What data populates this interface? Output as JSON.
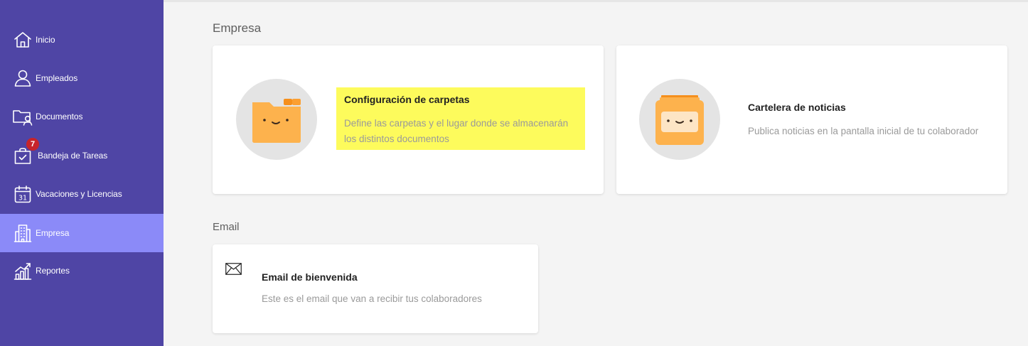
{
  "sidebar": {
    "items": [
      {
        "label": "Inicio",
        "icon": "home-icon"
      },
      {
        "label": "Empleados",
        "icon": "person-icon"
      },
      {
        "label": "Documentos",
        "icon": "folder-person-icon"
      },
      {
        "label": "Bandeja de Tareas",
        "icon": "task-bag-icon",
        "badge": "7"
      },
      {
        "label": "Vacaciones y Licencias",
        "icon": "calendar-icon"
      },
      {
        "label": "Empresa",
        "icon": "building-icon",
        "active": true
      },
      {
        "label": "Reportes",
        "icon": "chart-icon"
      }
    ]
  },
  "main": {
    "empresa_section": {
      "title": "Empresa",
      "cards": [
        {
          "title": "Configuración de carpetas",
          "description": "Define las carpetas y el lugar donde se almacenarán los distintos documentos",
          "icon": "folder-face-icon",
          "highlighted": true
        },
        {
          "title": "Cartelera de noticias",
          "description": "Publica noticias en la pantalla inicial de tu colaborador",
          "icon": "board-face-icon"
        }
      ]
    },
    "email_section": {
      "title": "Email",
      "cards": [
        {
          "title": "Email de bienvenida",
          "description": "Este es el email que van a recibir tus colaboradores",
          "icon": "envelope-icon"
        }
      ]
    }
  },
  "colors": {
    "sidebar_bg": "#4f45a5",
    "sidebar_active": "#8b8af8",
    "badge": "#c7242a",
    "highlight": "#fdfb5c",
    "illustration_orange": "#fdb24d"
  }
}
